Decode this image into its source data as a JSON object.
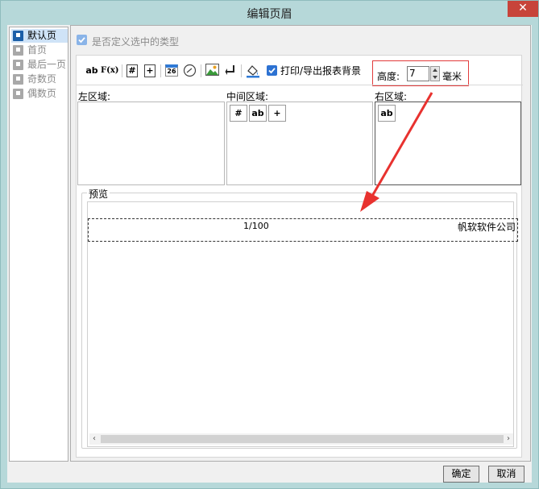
{
  "window": {
    "title": "编辑页眉",
    "close_glyph": "✕"
  },
  "nav": {
    "items": [
      {
        "label": "默认页",
        "state": "selected"
      },
      {
        "label": "首页",
        "state": "disabled"
      },
      {
        "label": "最后一页",
        "state": "disabled"
      },
      {
        "label": "奇数页",
        "state": "disabled"
      },
      {
        "label": "偶数页",
        "state": "disabled"
      }
    ]
  },
  "custom_type": {
    "label": "是否定义选中的类型",
    "checked": true,
    "enabled": false
  },
  "toolbar": {
    "text_btn": "ab",
    "formula_btn": "F(x)",
    "page_num_btn": "#",
    "total_pages_btn": "+",
    "date_btn": "26",
    "print_bg_label": "打印/导出报表背景",
    "print_bg_checked": true,
    "height_label": "高度:",
    "height_value": "7",
    "height_unit": "毫米"
  },
  "regions": {
    "left_label": "左区域:",
    "center_label": "中间区域:",
    "right_label": "右区域:",
    "center_buttons": [
      "#",
      "ab",
      "+"
    ],
    "right_buttons": [
      "ab"
    ]
  },
  "preview": {
    "legend": "预览",
    "page_number_text": "1/100",
    "company_text": "帆软软件公司"
  },
  "buttons": {
    "ok": "确定",
    "cancel": "取消"
  },
  "colors": {
    "highlight_box": "#e23b3b",
    "arrow": "#e8322f",
    "selected_nav_icon": "#1c5fa8"
  }
}
